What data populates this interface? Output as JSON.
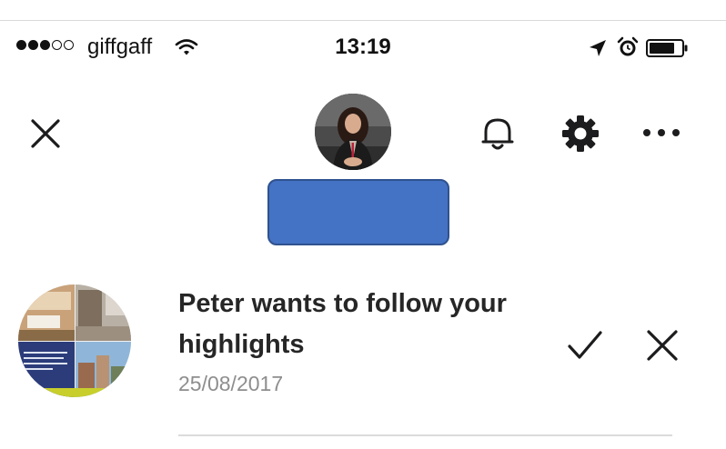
{
  "status_bar": {
    "signal_dots_filled": 3,
    "signal_dots_total": 5,
    "carrier": "giffgaff",
    "time": "13:19",
    "icons": [
      "wifi-icon",
      "location-arrow-icon",
      "alarm-clock-icon",
      "battery-icon"
    ]
  },
  "header": {
    "close_icon": "close-icon",
    "bell_icon": "bell-icon",
    "settings_icon": "gear-icon",
    "more_icon": "more-options-icon",
    "redaction_color": "#4472c4"
  },
  "request": {
    "message_line1": "Peter wants to follow your",
    "message_line2": "highlights",
    "date": "25/08/2017",
    "accept_icon": "checkmark-icon",
    "reject_icon": "close-icon"
  }
}
